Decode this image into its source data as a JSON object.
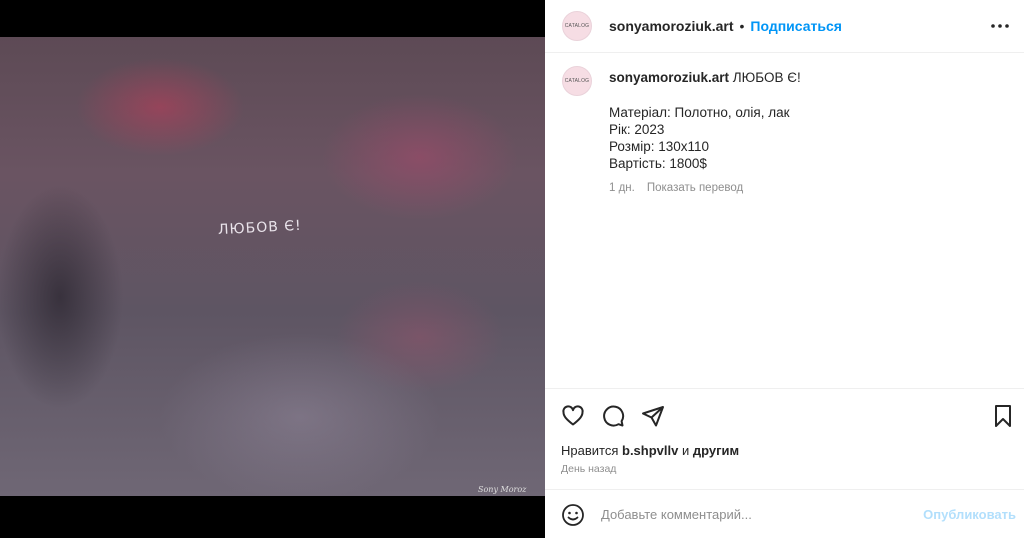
{
  "post_image": {
    "painting_text": "ЛЮБОВ Є!",
    "signature": "Sony Moroz"
  },
  "header": {
    "avatar_text": "CATALOG",
    "username": "sonyamoroziuk.art",
    "separator": "•",
    "follow_label": "Подписаться"
  },
  "caption": {
    "avatar_text": "CATALOG",
    "username": "sonyamoroziuk.art",
    "title": "ЛЮБОВ Є!",
    "lines": [
      "Матеріал: Полотно, олія, лак",
      "Рік: 2023",
      "Розмір: 130х110",
      "Вартість: 1800$"
    ],
    "age": "1 дн.",
    "translate_label": "Показать перевод"
  },
  "actions": {
    "icons": [
      "heart-icon",
      "comment-icon",
      "share-icon",
      "bookmark-icon"
    ]
  },
  "likes": {
    "prefix": "Нравится",
    "user": "b.shpvllv",
    "conj": "и",
    "others": "другим"
  },
  "timestamp": "День назад",
  "comment": {
    "placeholder": "Добавьте комментарий...",
    "publish_label": "Опубликовать"
  },
  "colors": {
    "accent": "#0095f6",
    "publish_disabled": "#b2dffc"
  }
}
